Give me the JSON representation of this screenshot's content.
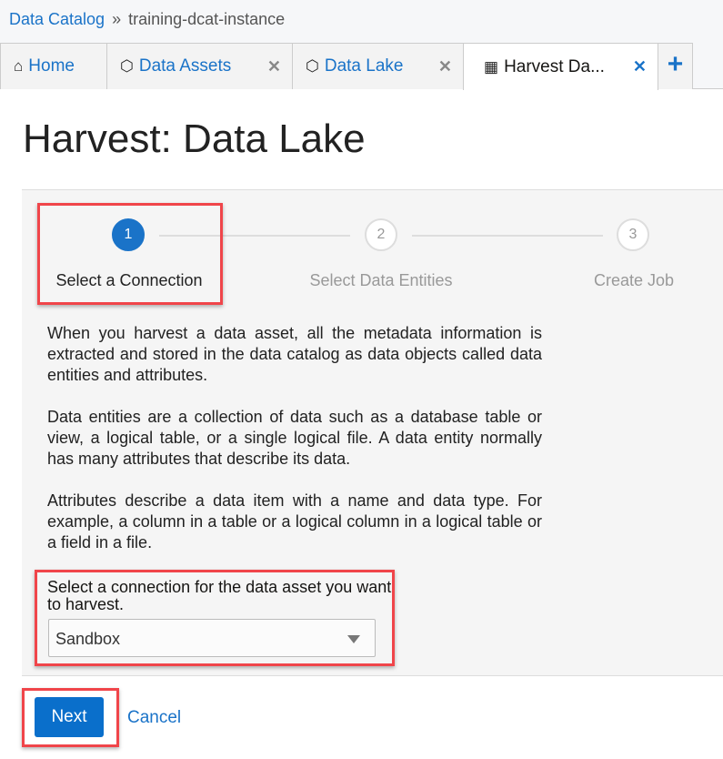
{
  "breadcrumb": {
    "root": "Data Catalog",
    "separator": "»",
    "current": "training-dcat-instance"
  },
  "tabs": [
    {
      "label": "Home",
      "icon": "home-icon"
    },
    {
      "label": "Data Assets",
      "icon": "cube-icon",
      "close": "✕"
    },
    {
      "label": "Data Lake",
      "icon": "cube-icon",
      "close": "✕"
    },
    {
      "label": "Harvest Da...",
      "icon": "table-icon",
      "close": "✕",
      "active": true
    }
  ],
  "add_tab": "+",
  "title": "Harvest: Data Lake",
  "steps": [
    {
      "num": "1",
      "label": "Select a Connection",
      "active": true
    },
    {
      "num": "2",
      "label": "Select Data Entities"
    },
    {
      "num": "3",
      "label": "Create Job"
    }
  ],
  "paragraphs": [
    "When you harvest a data asset, all the metadata information is extracted and stored in the data catalog as data objects called data entities and attributes.",
    "Data entities are a collection of data such as a database table or view, a logical table, or a single logical file. A data entity normally has many attributes that describe its data.",
    "Attributes describe a data item with a name and data type. For example, a column in a table or a logical column in a logical table or a field in a file."
  ],
  "connection": {
    "label": "Select a connection for the data asset you want to harvest.",
    "value": "Sandbox"
  },
  "buttons": {
    "next": "Next",
    "cancel": "Cancel"
  },
  "colors": {
    "accent": "#1a73c8",
    "annotation": "#f0454a"
  }
}
